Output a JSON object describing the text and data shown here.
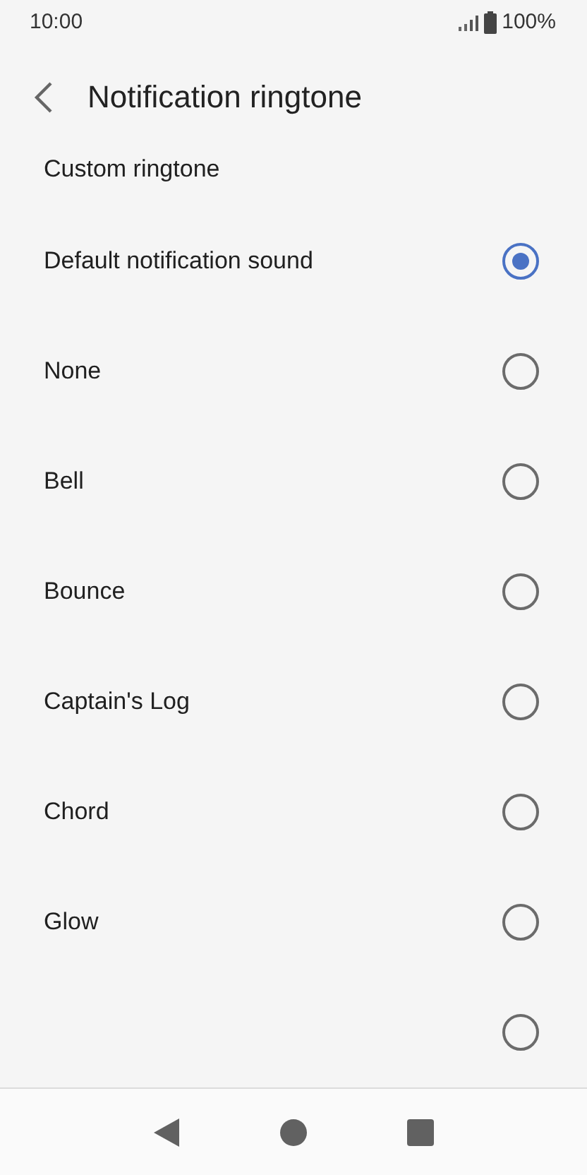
{
  "status_bar": {
    "time": "10:00",
    "battery": "100%"
  },
  "header": {
    "title": "Notification ringtone"
  },
  "custom_ringtone": {
    "label": "Custom ringtone"
  },
  "ringtones": [
    {
      "label": "Default notification sound",
      "selected": true
    },
    {
      "label": "None",
      "selected": false
    },
    {
      "label": "Bell",
      "selected": false
    },
    {
      "label": "Bounce",
      "selected": false
    },
    {
      "label": "Captain's Log",
      "selected": false
    },
    {
      "label": "Chord",
      "selected": false
    },
    {
      "label": "Glow",
      "selected": false
    },
    {
      "selected": false
    }
  ]
}
